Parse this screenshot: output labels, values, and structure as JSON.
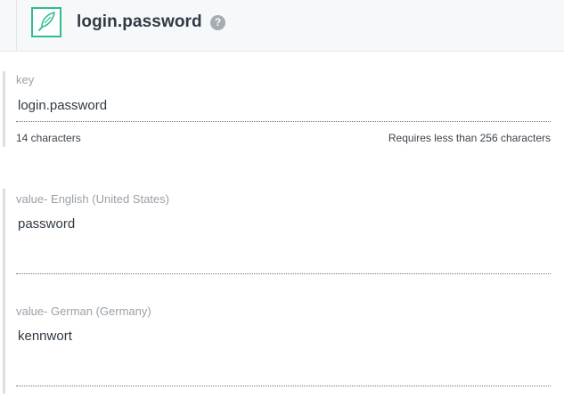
{
  "header": {
    "title": "login.password",
    "logo_icon": "feather-icon",
    "help_icon": "question-circle-icon",
    "help_symbol": "?",
    "accent_color": "#2ebd8f"
  },
  "key_field": {
    "label": "key",
    "value": "login.password",
    "char_count": "14 characters",
    "limit_text": "Requires less than 256 characters"
  },
  "values": [
    {
      "label": "value- English (United States)",
      "value": "password"
    },
    {
      "label": "value- German (Germany)",
      "value": "kennwort"
    }
  ]
}
